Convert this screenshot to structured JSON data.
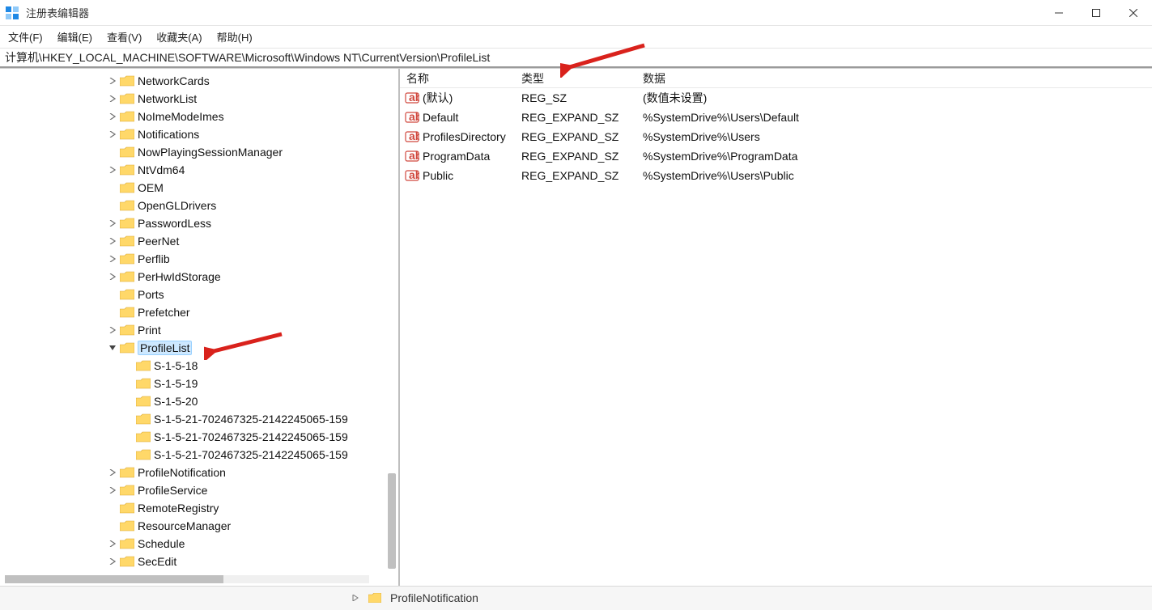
{
  "window": {
    "title": "注册表编辑器"
  },
  "menu": {
    "file": "文件(F)",
    "edit": "编辑(E)",
    "view": "查看(V)",
    "favorites": "收藏夹(A)",
    "help": "帮助(H)"
  },
  "address": "计算机\\HKEY_LOCAL_MACHINE\\SOFTWARE\\Microsoft\\Windows NT\\CurrentVersion\\ProfileList",
  "tree": [
    {
      "indent": 1,
      "expand": "closed",
      "label": "NetworkCards"
    },
    {
      "indent": 1,
      "expand": "closed",
      "label": "NetworkList"
    },
    {
      "indent": 1,
      "expand": "closed",
      "label": "NoImeModeImes"
    },
    {
      "indent": 1,
      "expand": "closed",
      "label": "Notifications"
    },
    {
      "indent": 1,
      "expand": "none",
      "label": "NowPlayingSessionManager"
    },
    {
      "indent": 1,
      "expand": "closed",
      "label": "NtVdm64"
    },
    {
      "indent": 1,
      "expand": "none",
      "label": "OEM"
    },
    {
      "indent": 1,
      "expand": "none",
      "label": "OpenGLDrivers"
    },
    {
      "indent": 1,
      "expand": "closed",
      "label": "PasswordLess"
    },
    {
      "indent": 1,
      "expand": "closed",
      "label": "PeerNet"
    },
    {
      "indent": 1,
      "expand": "closed",
      "label": "Perflib"
    },
    {
      "indent": 1,
      "expand": "closed",
      "label": "PerHwIdStorage"
    },
    {
      "indent": 1,
      "expand": "none",
      "label": "Ports"
    },
    {
      "indent": 1,
      "expand": "none",
      "label": "Prefetcher"
    },
    {
      "indent": 1,
      "expand": "closed",
      "label": "Print"
    },
    {
      "indent": 1,
      "expand": "open",
      "label": "ProfileList",
      "selected": true
    },
    {
      "indent": 2,
      "expand": "none",
      "label": "S-1-5-18"
    },
    {
      "indent": 2,
      "expand": "none",
      "label": "S-1-5-19"
    },
    {
      "indent": 2,
      "expand": "none",
      "label": "S-1-5-20"
    },
    {
      "indent": 2,
      "expand": "none",
      "label": "S-1-5-21-702467325-2142245065-159"
    },
    {
      "indent": 2,
      "expand": "none",
      "label": "S-1-5-21-702467325-2142245065-159"
    },
    {
      "indent": 2,
      "expand": "none",
      "label": "S-1-5-21-702467325-2142245065-159"
    },
    {
      "indent": 1,
      "expand": "closed",
      "label": "ProfileNotification"
    },
    {
      "indent": 1,
      "expand": "closed",
      "label": "ProfileService"
    },
    {
      "indent": 1,
      "expand": "none",
      "label": "RemoteRegistry"
    },
    {
      "indent": 1,
      "expand": "none",
      "label": "ResourceManager"
    },
    {
      "indent": 1,
      "expand": "closed",
      "label": "Schedule"
    },
    {
      "indent": 1,
      "expand": "closed",
      "label": "SecEdit"
    }
  ],
  "list": {
    "columns": {
      "name": "名称",
      "type": "类型",
      "data": "数据"
    },
    "rows": [
      {
        "name": "(默认)",
        "type": "REG_SZ",
        "data": "(数值未设置)"
      },
      {
        "name": "Default",
        "type": "REG_EXPAND_SZ",
        "data": "%SystemDrive%\\Users\\Default"
      },
      {
        "name": "ProfilesDirectory",
        "type": "REG_EXPAND_SZ",
        "data": "%SystemDrive%\\Users"
      },
      {
        "name": "ProgramData",
        "type": "REG_EXPAND_SZ",
        "data": "%SystemDrive%\\ProgramData"
      },
      {
        "name": "Public",
        "type": "REG_EXPAND_SZ",
        "data": "%SystemDrive%\\Users\\Public"
      }
    ]
  },
  "bottom": {
    "label": "ProfileNotification"
  }
}
